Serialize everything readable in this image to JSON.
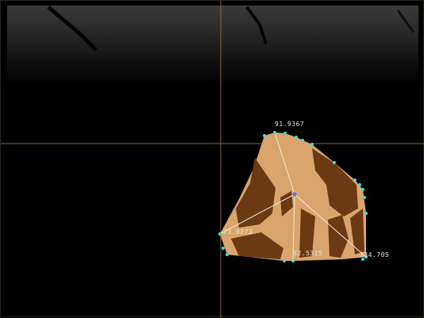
{
  "viewer": {
    "crosshair_color": "#8a6a2a",
    "hull_fill": "#d9a56c",
    "shadow_fill": "#6b3a12",
    "vertex_color": "#35e0e0",
    "center_color": "#4a7cff",
    "line_color": "#f0e6d8"
  },
  "measurements": {
    "top": "91.9367",
    "left": "73.8273",
    "bottom": "52.5315",
    "right": "134.705"
  }
}
